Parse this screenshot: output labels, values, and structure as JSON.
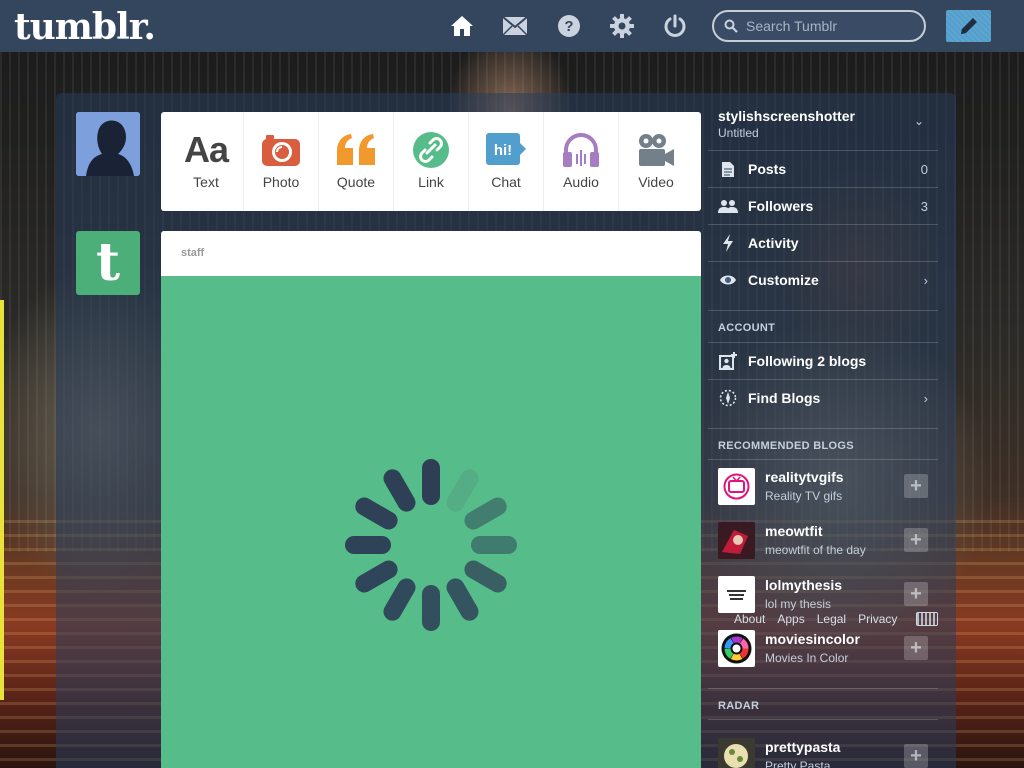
{
  "header": {
    "logo": "tumblr.",
    "search_placeholder": "Search Tumblr",
    "icons": [
      "home-icon",
      "inbox-icon",
      "help-icon",
      "settings-icon",
      "logout-icon",
      "compose-icon"
    ]
  },
  "post_types": [
    {
      "label": "Text",
      "glyph": "Aa",
      "icon": "text-icon",
      "color": "#444444"
    },
    {
      "label": "Photo",
      "glyph": "",
      "icon": "camera-icon",
      "color": "#d95e40"
    },
    {
      "label": "Quote",
      "glyph": "“",
      "icon": "quote-icon",
      "color": "#f2992e"
    },
    {
      "label": "Link",
      "glyph": "",
      "icon": "link-icon",
      "color": "#56bc8a"
    },
    {
      "label": "Chat",
      "glyph": "hi!",
      "icon": "chat-icon",
      "color": "#529ecc"
    },
    {
      "label": "Audio",
      "glyph": "",
      "icon": "headphones-icon",
      "color": "#a77dc2"
    },
    {
      "label": "Video",
      "glyph": "",
      "icon": "video-camera-icon",
      "color": "#748089"
    }
  ],
  "post": {
    "author": "staff",
    "background": "#56bc8a"
  },
  "sidebar": {
    "blog_name": "stylishscreenshotter",
    "blog_title": "Untitled",
    "menu": [
      {
        "label": "Posts",
        "count": "0",
        "icon": "posts-icon"
      },
      {
        "label": "Followers",
        "count": "3",
        "icon": "followers-icon"
      },
      {
        "label": "Activity",
        "count": "",
        "icon": "lightning-icon"
      },
      {
        "label": "Customize",
        "count": "",
        "icon": "eye-icon"
      }
    ],
    "account_heading": "ACCOUNT",
    "account": [
      {
        "label": "Following 2 blogs",
        "icon": "add-following-icon"
      },
      {
        "label": "Find Blogs",
        "icon": "compass-icon"
      }
    ],
    "recommended_heading": "RECOMMENDED BLOGS",
    "recommended": [
      {
        "name": "realitytvgifs",
        "title": "Reality TV gifs"
      },
      {
        "name": "meowtfit",
        "title": "meowtfit of the day"
      },
      {
        "name": "lolmythesis",
        "title": "lol my thesis"
      },
      {
        "name": "moviesincolor",
        "title": "Movies In Color"
      }
    ],
    "radar_heading": "RADAR",
    "radar": [
      {
        "name": "prettypasta",
        "title": "Pretty Pasta"
      }
    ]
  },
  "footer": {
    "links": [
      "About",
      "Apps",
      "Legal",
      "Privacy"
    ]
  },
  "colors": {
    "header_bg": "#34465e",
    "compose_bg": "#529ecc",
    "staff_avatar": "#4caf7a"
  }
}
